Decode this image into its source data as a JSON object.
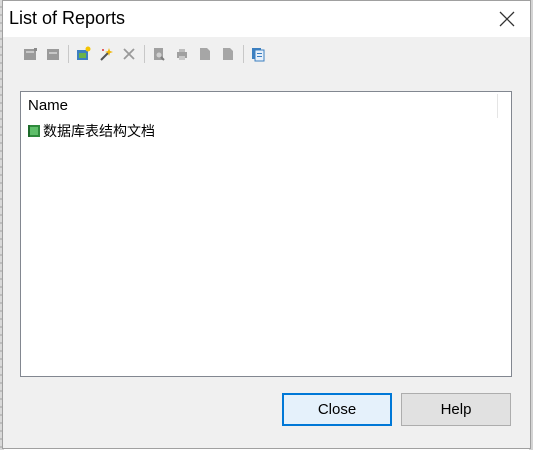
{
  "window": {
    "title": "List of Reports",
    "close_icon": "close-icon"
  },
  "toolbar": {
    "buttons": [
      {
        "name": "properties-icon",
        "enabled": false
      },
      {
        "name": "delete-icon",
        "enabled": false
      },
      {
        "name": "new-report-icon",
        "enabled": true
      },
      {
        "name": "wizard-icon",
        "enabled": true
      },
      {
        "name": "delete-x-icon",
        "enabled": false
      },
      {
        "name": "preview-icon",
        "enabled": false
      },
      {
        "name": "print-icon",
        "enabled": false
      },
      {
        "name": "export-icon",
        "enabled": false
      },
      {
        "name": "export-alt-icon",
        "enabled": false
      },
      {
        "name": "copy-icon",
        "enabled": true
      }
    ]
  },
  "list": {
    "column_name": "Name",
    "rows": [
      {
        "label": "数据库表结构文档",
        "icon": "report-book-icon"
      }
    ]
  },
  "buttons": {
    "close": "Close",
    "help": "Help"
  },
  "colors": {
    "default_button_border": "#0078d7",
    "dialog_bg": "#f0f0f0"
  }
}
